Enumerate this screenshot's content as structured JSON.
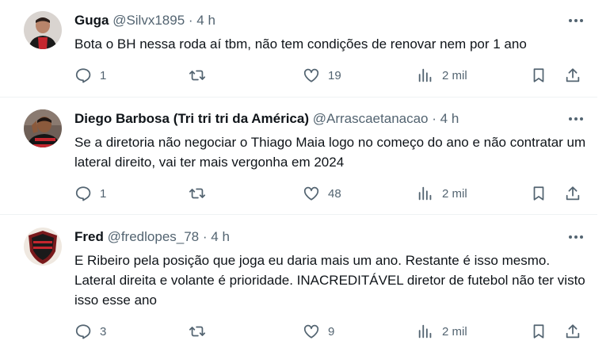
{
  "tweets": [
    {
      "name": "Guga",
      "handle": "@Silvx1895",
      "sep": "·",
      "time": "4 h",
      "text": "Bota o BH nessa roda aí tbm, não tem condições de renovar nem por 1 ano",
      "replies": "1",
      "likes": "19",
      "views": "2 mil"
    },
    {
      "name": "Diego Barbosa (Tri tri tri da América)",
      "handle": "@Arrascaetanacao",
      "sep": "·",
      "time": "4 h",
      "text": "Se a diretoria não negociar o Thiago Maia logo no começo do ano e não contratar um lateral direito, vai ter mais vergonha em 2024",
      "replies": "1",
      "likes": "48",
      "views": "2 mil"
    },
    {
      "name": "Fred",
      "handle": "@fredlopes_78",
      "sep": "·",
      "time": "4 h",
      "text": "E Ribeiro pela posição que joga eu daria mais um ano. Restante é isso mesmo. Lateral direita e volante é prioridade. INACREDITÁVEL diretor de futebol não ter visto isso esse ano",
      "replies": "3",
      "likes": "9",
      "views": "2 mil"
    }
  ],
  "icons": [
    "more-icon",
    "reply-icon",
    "retweet-icon",
    "like-icon",
    "views-icon",
    "bookmark-icon",
    "share-icon"
  ],
  "colors": {
    "text": "#0f1419",
    "secondary": "#536471",
    "divider": "#eff3f4"
  }
}
